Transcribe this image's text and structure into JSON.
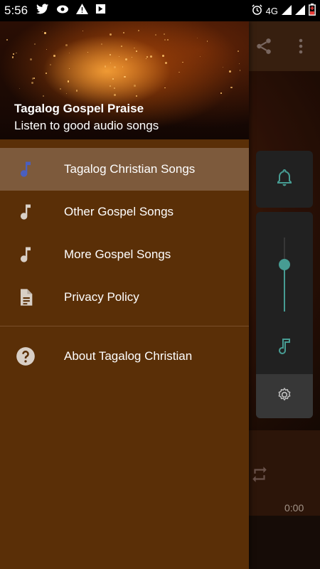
{
  "status_bar": {
    "time": "5:56",
    "network": "4G",
    "left_icons": [
      "twitter-icon",
      "app-icon",
      "warning-icon",
      "app-alt-icon"
    ],
    "right_icons": [
      "alarm-icon",
      "signal-icon",
      "signal-icon",
      "battery-icon"
    ]
  },
  "drawer": {
    "header": {
      "title": "Tagalog Gospel Praise",
      "subtitle": "Listen to good audio songs"
    },
    "items": [
      {
        "label": "Tagalog Christian Songs",
        "icon": "music-note-icon",
        "selected": true
      },
      {
        "label": "Other Gospel Songs",
        "icon": "music-note-icon",
        "selected": false
      },
      {
        "label": "More Gospel Songs",
        "icon": "music-note-icon",
        "selected": false
      },
      {
        "label": "Privacy Policy",
        "icon": "document-icon",
        "selected": false
      }
    ],
    "secondary_items": [
      {
        "label": "About Tagalog Christian",
        "icon": "help-icon"
      }
    ]
  },
  "player": {
    "time": "0:00",
    "toolbar_icons": [
      "share-icon",
      "more-vert-icon"
    ]
  },
  "volume_panel": {
    "level": 0.63,
    "accent_color": "#5fd0c4",
    "icons": [
      "bell-icon",
      "music-note-icon",
      "settings-icon"
    ]
  },
  "colors": {
    "drawer_bg": "#5a2f07",
    "selected_bg": "#7d5a3c",
    "selected_icon": "#4a5fc0",
    "icon_default": "#d8cfc6"
  }
}
